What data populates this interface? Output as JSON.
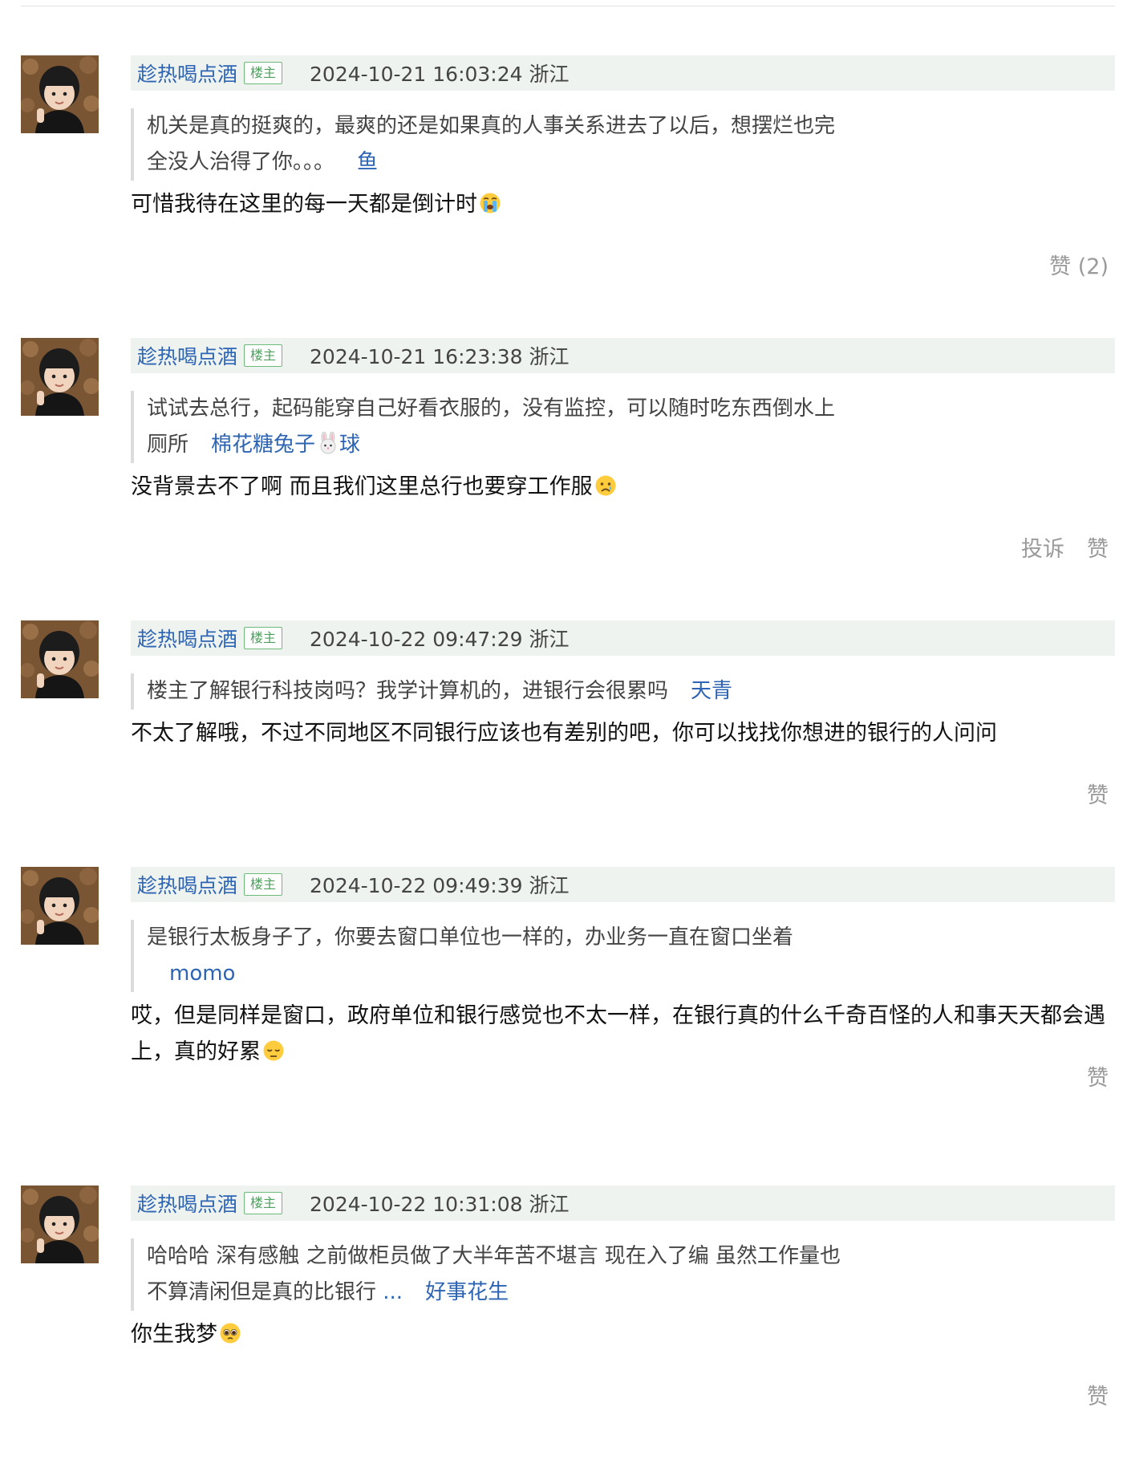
{
  "comments": [
    {
      "username": "趁热喝点酒",
      "badge": "楼主",
      "timestamp": "2024-10-21 16:03:24",
      "location": "浙江",
      "quote_text": "机关是真的挺爽的，最爽的还是如果真的人事关系进去了以后，想摆烂也完全没人治得了你。。。",
      "quote_author": "鱼",
      "reply_text": "可惜我待在这里的每一天都是倒计时",
      "reply_emoji": "loudly-crying-emoji",
      "like_label": "赞 (2)"
    },
    {
      "username": "趁热喝点酒",
      "badge": "楼主",
      "timestamp": "2024-10-21 16:23:38",
      "location": "浙江",
      "quote_text": "试试去总行，起码能穿自己好看衣服的，没有监控，可以随时吃东西倒水上厕所",
      "quote_author_part1": "棉花糖兔子",
      "quote_author_emoji": "rabbit-face-emoji",
      "quote_author_part2": "球",
      "reply_text": "没背景去不了啊 而且我们这里总行也要穿工作服",
      "reply_emoji": "crying-face-emoji",
      "report_label": "投诉",
      "like_label": "赞"
    },
    {
      "username": "趁热喝点酒",
      "badge": "楼主",
      "timestamp": "2024-10-22 09:47:29",
      "location": "浙江",
      "quote_text": "楼主了解银行科技岗吗？我学计算机的，进银行会很累吗",
      "quote_author": "天青",
      "reply_text": "不太了解哦，不过不同地区不同银行应该也有差别的吧，你可以找找你想进的银行的人问问",
      "like_label": "赞"
    },
    {
      "username": "趁热喝点酒",
      "badge": "楼主",
      "timestamp": "2024-10-22 09:49:39",
      "location": "浙江",
      "quote_text": "是银行太板身子了，你要去窗口单位也一样的，办业务一直在窗口坐着",
      "quote_author": "momo",
      "reply_text": "哎，但是同样是窗口，政府单位和银行感觉也不太一样，在银行真的什么千奇百怪的人和事天天都会遇上，真的好累",
      "reply_emoji": "pensive-face-emoji",
      "like_label": "赞"
    },
    {
      "username": "趁热喝点酒",
      "badge": "楼主",
      "timestamp": "2024-10-22 10:31:08",
      "location": "浙江",
      "quote_text": "哈哈哈 深有感触 之前做柜员做了大半年苦不堪言 现在入了编 虽然工作量也不算清闲但是真的比银行",
      "quote_ellipsis": "...",
      "quote_author": "好事花生",
      "reply_text": "你生我梦",
      "reply_emoji": "pleading-face-emoji",
      "like_label": "赞"
    }
  ],
  "colors": {
    "link": "#2d64b3",
    "header_bg": "#eef3ef",
    "badge": "#4fa05e",
    "muted": "#9a9a9a"
  }
}
